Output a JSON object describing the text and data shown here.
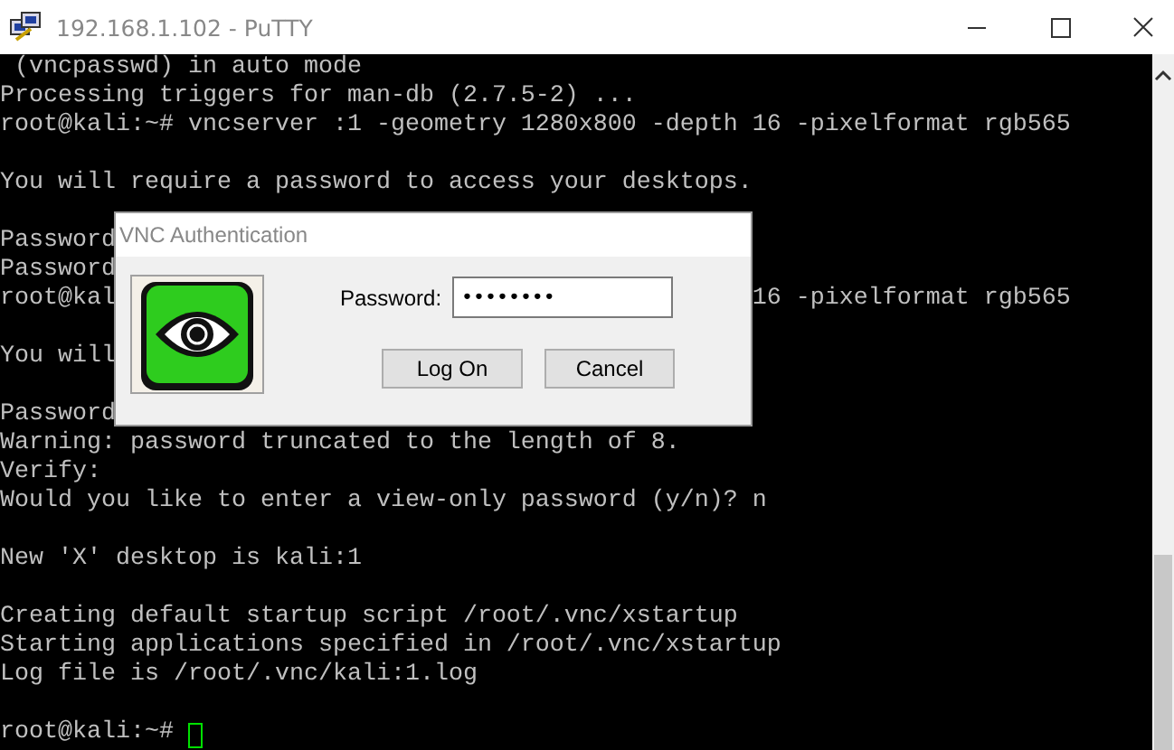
{
  "window": {
    "title": "192.168.1.102 - PuTTY"
  },
  "terminal": {
    "lines": [
      {
        "text": " (vncpasswd) in auto mode",
        "blank_line_before": false
      },
      {
        "text": "Processing triggers for man-db (2.7.5-2) ...",
        "blank_line_before": false
      },
      {
        "text": "root@kali:~# vncserver :1 -geometry 1280x800 -depth 16 -pixelformat rgb565",
        "blank_line_before": false
      },
      {
        "text": "You will require a password to access your desktops.",
        "blank_line_before": true
      },
      {
        "text": "Password",
        "blank_line_before": true
      },
      {
        "text": "Password",
        "blank_line_before": false
      },
      {
        "text": "root@kal",
        "tail": "16 -pixelformat rgb565",
        "blank_line_before": false
      },
      {
        "text": "You will",
        "blank_line_before": true
      },
      {
        "text": "Password",
        "blank_line_before": true
      },
      {
        "text": "Warning: password truncated to the length of 8.",
        "blank_line_before": false
      },
      {
        "text": "Verify:",
        "blank_line_before": false
      },
      {
        "text": "Would you like to enter a view-only password (y/n)? n",
        "blank_line_before": false
      },
      {
        "text": "New 'X' desktop is kali:1",
        "blank_line_before": true
      },
      {
        "text": "Creating default startup script /root/.vnc/xstartup",
        "blank_line_before": true
      },
      {
        "text": "Starting applications specified in /root/.vnc/xstartup",
        "blank_line_before": false
      },
      {
        "text": "Log file is /root/.vnc/kali:1.log",
        "blank_line_before": false
      },
      {
        "text": "root@kali:~# ",
        "cursor": true,
        "blank_line_before": true
      }
    ]
  },
  "dialog": {
    "title": "VNC Authentication",
    "password_label": "Password:",
    "password_value": "••••••••",
    "buttons": [
      "Log On",
      "Cancel"
    ]
  }
}
